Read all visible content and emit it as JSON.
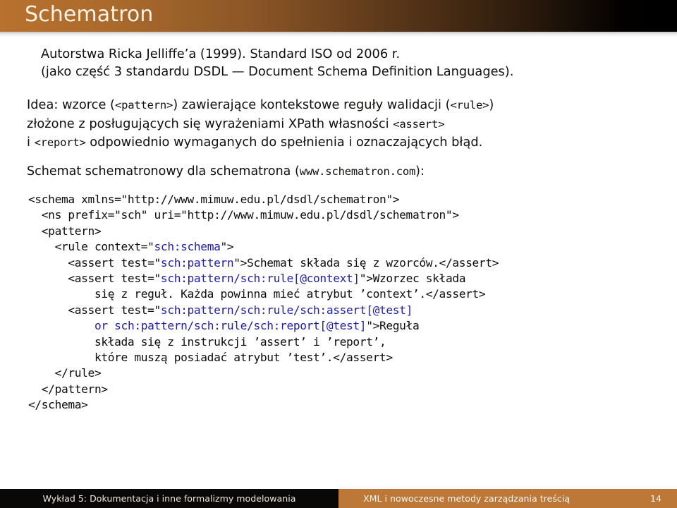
{
  "header": {
    "title": "Schematron",
    "gradient_from": "#b9712e",
    "gradient_to": "#000000",
    "title_color": "#f7f2e6"
  },
  "content": {
    "intro": [
      "Autorstwa Ricka Jelliffe’a (1999). Standard ISO od 2006 r.",
      "(jako część 3 standardu DSDL — Document Schema Definition Languages)."
    ],
    "idea": {
      "line1_a": "Idea: wzorce (",
      "line1_mono": "<pattern>",
      "line1_b": ") zawierające kontekstowe reguły walidacji (",
      "line1_mono2": "<rule>",
      "line1_c": ")",
      "line2_a": "złożone z posługujących się wyrażeniami XPath własności ",
      "line2_mono": "<assert>",
      "line3_a": "i ",
      "line3_mono": "<report>",
      "line3_b": " odpowiednio wymaganych do spełnienia i oznaczających błąd."
    },
    "schemat": {
      "prefix": "Schemat schematronowy dla schematrona (",
      "mono": "www.schematron.com",
      "suffix": "):"
    }
  },
  "code": {
    "xpath_color": "#1f1fa8",
    "lines": [
      [
        {
          "t": "<schema xmlns=\"http://www.mimuw.edu.pl/dsdl/schematron\">",
          "c": "plain"
        }
      ],
      [
        {
          "t": "  <ns prefix=\"sch\" uri=\"http://www.mimuw.edu.pl/dsdl/schematron\">",
          "c": "plain"
        }
      ],
      [
        {
          "t": "  <pattern>",
          "c": "plain"
        }
      ],
      [
        {
          "t": "    <rule context=\"",
          "c": "plain"
        },
        {
          "t": "sch:schema",
          "c": "xpath"
        },
        {
          "t": "\">",
          "c": "plain"
        }
      ],
      [
        {
          "t": "      <assert test=\"",
          "c": "plain"
        },
        {
          "t": "sch:pattern",
          "c": "xpath"
        },
        {
          "t": "\">Schemat składa się z wzorców.</assert>",
          "c": "plain"
        }
      ],
      [
        {
          "t": "      <assert test=\"",
          "c": "plain"
        },
        {
          "t": "sch:pattern/sch:rule[@context]",
          "c": "xpath"
        },
        {
          "t": "\">Wzorzec składa",
          "c": "plain"
        }
      ],
      [
        {
          "t": "          się z reguł. Każda powinna mieć atrybut ’context’.</assert>",
          "c": "plain"
        }
      ],
      [
        {
          "t": "      <assert test=\"",
          "c": "plain"
        },
        {
          "t": "sch:pattern/sch:rule/sch:assert[@test]",
          "c": "xpath"
        }
      ],
      [
        {
          "t": "          ",
          "c": "plain"
        },
        {
          "t": "or sch:pattern/sch:rule/sch:report[@test]",
          "c": "xpath"
        },
        {
          "t": "\">Reguła",
          "c": "plain"
        }
      ],
      [
        {
          "t": "          składa się z instrukcji ’assert’ i ’report’,",
          "c": "plain"
        }
      ],
      [
        {
          "t": "          które muszą posiadać atrybut ’test’.</assert>",
          "c": "plain"
        }
      ],
      [
        {
          "t": "    </rule>",
          "c": "plain"
        }
      ],
      [
        {
          "t": "  </pattern>",
          "c": "plain"
        }
      ],
      [
        {
          "t": "</schema>",
          "c": "plain"
        }
      ]
    ]
  },
  "footer": {
    "left_text": "Wykład 5: Dokumentacja i inne formalizmy modelowania",
    "right_text": "XML i nowoczesne metody zarządzania treścią",
    "page_number": "14",
    "left_bg": "#0a0806",
    "right_bg": "#bd7736"
  }
}
